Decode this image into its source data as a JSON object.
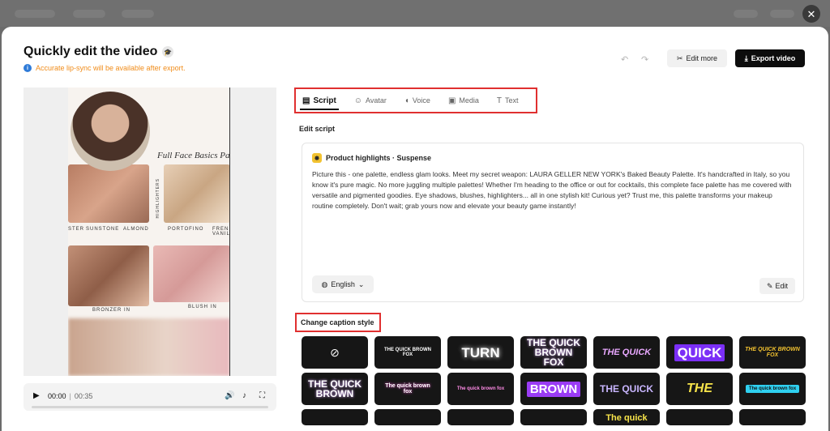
{
  "header": {
    "title": "Quickly edit the video",
    "notice": "Accurate lip-sync will be available after export.",
    "edit_more": "Edit more",
    "export": "Export video"
  },
  "video": {
    "panel_heading": "Full Face Basics Pal",
    "swatch_labels": [
      "STER",
      "SUNSTONE",
      "ALMOND",
      "PORTOFINO",
      "FREN VANIL",
      "BRONZER IN",
      "BLUSH IN"
    ],
    "vertical_label": "HIGHLIGHTERS",
    "current_time": "00:00",
    "duration": "00:35",
    "progress": 0
  },
  "tabs": [
    {
      "label": "Script",
      "icon": "script-icon",
      "active": true
    },
    {
      "label": "Avatar",
      "icon": "avatar-icon",
      "active": false
    },
    {
      "label": "Voice",
      "icon": "voice-icon",
      "active": false
    },
    {
      "label": "Media",
      "icon": "media-icon",
      "active": false
    },
    {
      "label": "Text",
      "icon": "text-icon",
      "active": false
    }
  ],
  "script": {
    "section_label": "Edit script",
    "title": "Product highlights · Suspense",
    "body": "Picture this - one palette, endless glam looks. Meet my secret weapon: LAURA GELLER NEW YORK's Baked Beauty Palette. It's handcrafted in Italy, so you know it's pure magic. No more juggling multiple palettes! Whether I'm heading to the office or out for cocktails, this complete face palette has me covered with versatile and pigmented goodies. Eye shadows, blushes, highlighters... all in one stylish kit! Curious yet? Trust me, this palette transforms your makeup routine completely. Don't wait; grab yours now and elevate your beauty game instantly!",
    "language": "English",
    "edit_label": "Edit"
  },
  "captions": {
    "section_label": "Change caption style",
    "styles": [
      {
        "id": "none",
        "text": "⃠"
      },
      {
        "id": "s1",
        "text": "THE QUICK BROWN FOX",
        "color": "#ffffff",
        "size": 6
      },
      {
        "id": "s2",
        "text": "TURN",
        "color": "#ffffff",
        "size": 17,
        "glow": true
      },
      {
        "id": "s3",
        "text": "THE QUICK BROWN FOX",
        "color": "#ffffff",
        "size": 12,
        "accent": "#d9a8ff"
      },
      {
        "id": "s4",
        "text": "THE QUICK",
        "color": "#e9a8ff",
        "size": 11,
        "italic": true
      },
      {
        "id": "s5",
        "text": "QUICK",
        "color": "#ffffff",
        "size": 17,
        "bg": "#7b2ff7"
      },
      {
        "id": "s6",
        "text": "THE QUICK BROWN FOX",
        "color": "#f2c230",
        "size": 7,
        "italic": true
      },
      {
        "id": "s7",
        "text": "THE QUICK BROWN",
        "color": "#ffffff",
        "size": 12,
        "accent": "#d9a8ff"
      },
      {
        "id": "s8",
        "text": "The quick brown fox",
        "color": "#ffffff",
        "size": 7,
        "accent": "#ff4fd8"
      },
      {
        "id": "s9",
        "text": "The quick brown fox",
        "color": "#ff8be6",
        "size": 6
      },
      {
        "id": "s10",
        "text": "BROWN",
        "color": "#ffffff",
        "size": 15,
        "bg": "#9a3cf5"
      },
      {
        "id": "s11",
        "text": "THE QUICK",
        "color": "#c9b6ff",
        "size": 12
      },
      {
        "id": "s12",
        "text": "THE",
        "color": "#f7e44a",
        "size": 16,
        "italic": true
      },
      {
        "id": "s13",
        "text": "The quick brown fox",
        "color": "#111111",
        "size": 6,
        "bg": "#2fd0f0"
      },
      {
        "id": "s14",
        "text": "",
        "color": "#ffffff",
        "size": 10
      },
      {
        "id": "s15",
        "text": "",
        "color": "#ffffff",
        "size": 10
      },
      {
        "id": "s16",
        "text": "",
        "color": "#f7e44a",
        "size": 10
      },
      {
        "id": "s17",
        "text": "",
        "color": "#ffffff",
        "size": 10
      },
      {
        "id": "s18",
        "text": "The quick",
        "color": "#f7e44a",
        "size": 11
      },
      {
        "id": "s19",
        "text": "",
        "color": "#f7e44a",
        "size": 10
      },
      {
        "id": "s20",
        "text": "",
        "color": "#2fd0f0",
        "size": 10
      }
    ]
  }
}
